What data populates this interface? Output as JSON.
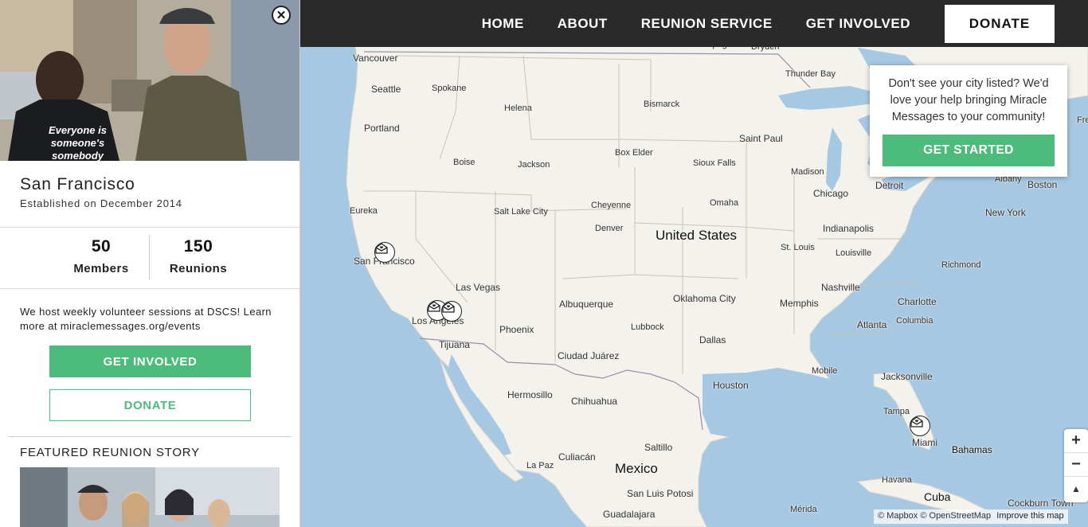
{
  "nav": {
    "items": [
      "HOME",
      "ABOUT",
      "REUNION SERVICE",
      "GET INVOLVED"
    ],
    "donate": "DONATE"
  },
  "sidebar": {
    "city": "San Francisco",
    "established": "Established on December 2014",
    "stats": {
      "members_value": "50",
      "members_label": "Members",
      "reunions_value": "150",
      "reunions_label": "Reunions"
    },
    "blurb": "We host weekly volunteer sessions at DSCS! Learn more at miraclemessages.org/events",
    "get_involved": "GET INVOLVED",
    "donate": "DONATE",
    "featured_title": "FEATURED REUNION STORY",
    "hero_shirt_text": [
      "Everyone is",
      "someone's",
      "somebody"
    ]
  },
  "popup": {
    "message": "Don't see your city listed? We'd love your help bringing Miracle Messages to your community!",
    "cta": "GET STARTED"
  },
  "map": {
    "labels": {
      "winnipeg": "Winnipeg",
      "dryden": "Dryden",
      "vancouver": "Vancouver",
      "seattle": "Seattle",
      "spokane": "Spokane",
      "helena": "Helena",
      "bismarck": "Bismarck",
      "thunder_bay": "Thunder Bay",
      "portland": "Portland",
      "boise": "Boise",
      "jackson": "Jackson",
      "box_elder": "Box Elder",
      "saint_paul": "Saint Paul",
      "sioux_falls": "Sioux Falls",
      "madison": "Madison",
      "detroit": "Detroit",
      "albany": "Albany",
      "boston": "Boston",
      "chicago": "Chicago",
      "eureka": "Eureka",
      "salt_lake_city": "Salt Lake City",
      "cheyenne": "Cheyenne",
      "omaha": "Omaha",
      "new_york": "New York",
      "denver": "Denver",
      "united_states": "United States",
      "indianapolis": "Indianapolis",
      "san_francisco": "San Francisco",
      "st_louis": "St. Louis",
      "louisville": "Louisville",
      "richmond": "Richmond",
      "las_vegas": "Las Vegas",
      "nashville": "Nashville",
      "albuquerque": "Albuquerque",
      "oklahoma_city": "Oklahoma City",
      "memphis": "Memphis",
      "charlotte": "Charlotte",
      "los_angeles": "Los Angeles",
      "columbia": "Columbia",
      "phoenix": "Phoenix",
      "lubbock": "Lubbock",
      "atlanta": "Atlanta",
      "tijuana": "Tijuana",
      "dallas": "Dallas",
      "ciudad_juarez": "Ciudad Juárez",
      "mobile": "Mobile",
      "jacksonville": "Jacksonville",
      "hermosillo": "Hermosillo",
      "houston": "Houston",
      "chihuahua": "Chihuahua",
      "tampa": "Tampa",
      "miami": "Miami",
      "saltillo": "Saltillo",
      "bahamas": "Bahamas",
      "culiacan": "Culiacán",
      "la_paz": "La Paz",
      "mexico": "Mexico",
      "havana": "Havana",
      "san_luis_potosi": "San Luis Potosi",
      "cuba": "Cuba",
      "cockburn_town": "Cockburn Town",
      "merida": "Mérida",
      "guadalajara": "Guadalajara",
      "fre": "Fre"
    },
    "attribution": "© Mapbox © OpenStreetMap",
    "improve": "Improve this map",
    "zoom_in": "+",
    "zoom_out": "−",
    "compass": "▲"
  },
  "colors": {
    "brand_green": "#4dbb7b",
    "nav_bg": "#2a2a2a",
    "water": "#a7c8e3",
    "land": "#f4f2ec"
  }
}
